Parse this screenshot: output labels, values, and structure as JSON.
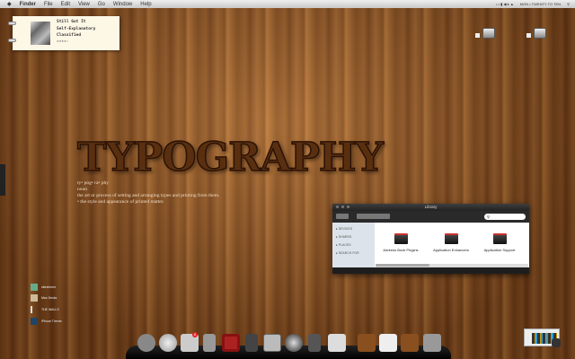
{
  "menubar": {
    "apple": "",
    "items": [
      "Finder",
      "File",
      "Edit",
      "View",
      "Go",
      "Window",
      "Help"
    ],
    "clock": "MON • TWENTY TO TEN"
  },
  "now_playing": {
    "title": "Still Got It",
    "artist": "Self-Explanatory",
    "album": "Classified",
    "rating": "★★★★☆"
  },
  "headline": "TYPOGRAPHY",
  "definition": {
    "pronunciation": "ty• pog• ra• phy",
    "pos": "noun",
    "sense1": "the art or process of setting and arranging types and printing from them.",
    "sense2": "• the style and appearance of printed matter."
  },
  "finder": {
    "title": "Library",
    "sidebar": [
      "DEVICES",
      "SHARED",
      "PLACES",
      "SEARCH FOR"
    ],
    "items": [
      "Address Book Plugins",
      "Application Enhancers",
      "Application Support"
    ]
  },
  "stacks": [
    "sitesforme",
    "Mac Decks",
    "THE WALLS",
    "iPhone Theme"
  ],
  "dock": {
    "mail_badge": "6"
  }
}
